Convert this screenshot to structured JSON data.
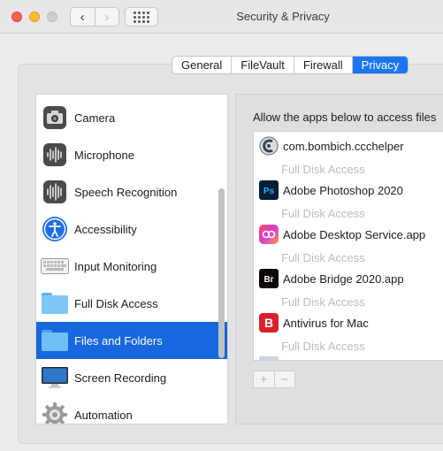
{
  "window": {
    "title": "Security & Privacy"
  },
  "nav": {
    "back": "‹",
    "forward": "›"
  },
  "tabs": [
    {
      "label": "General",
      "active": false
    },
    {
      "label": "FileVault",
      "active": false
    },
    {
      "label": "Firewall",
      "active": false
    },
    {
      "label": "Privacy",
      "active": true
    }
  ],
  "sidebar": {
    "items": [
      {
        "label": "Camera",
        "icon": "camera-icon"
      },
      {
        "label": "Microphone",
        "icon": "microphone-icon"
      },
      {
        "label": "Speech Recognition",
        "icon": "speech-recognition-icon"
      },
      {
        "label": "Accessibility",
        "icon": "accessibility-icon"
      },
      {
        "label": "Input Monitoring",
        "icon": "keyboard-icon"
      },
      {
        "label": "Full Disk Access",
        "icon": "folder-icon"
      },
      {
        "label": "Files and Folders",
        "icon": "folder-icon",
        "selected": true
      },
      {
        "label": "Screen Recording",
        "icon": "monitor-icon"
      },
      {
        "label": "Automation",
        "icon": "gear-icon"
      }
    ]
  },
  "main": {
    "header": "Allow the apps below to access files",
    "apps": [
      {
        "name": "com.bombich.ccchelper",
        "sub": "Full Disk Access",
        "icon": "ccc-icon"
      },
      {
        "name": "Adobe Photoshop 2020",
        "sub": "Full Disk Access",
        "icon": "photoshop-icon",
        "badge": "Ps"
      },
      {
        "name": "Adobe Desktop Service.app",
        "sub": "Full Disk Access",
        "icon": "adobe-cc-icon"
      },
      {
        "name": "Adobe Bridge 2020.app",
        "sub": "Full Disk Access",
        "icon": "bridge-icon",
        "badge": "Br"
      },
      {
        "name": "Antivirus for Mac",
        "sub": "Full Disk Access",
        "icon": "antivirus-icon",
        "badge": "B"
      }
    ],
    "add_label": "+",
    "remove_label": "−"
  },
  "colors": {
    "accent": "#1c76f2",
    "selection": "#1767de"
  }
}
